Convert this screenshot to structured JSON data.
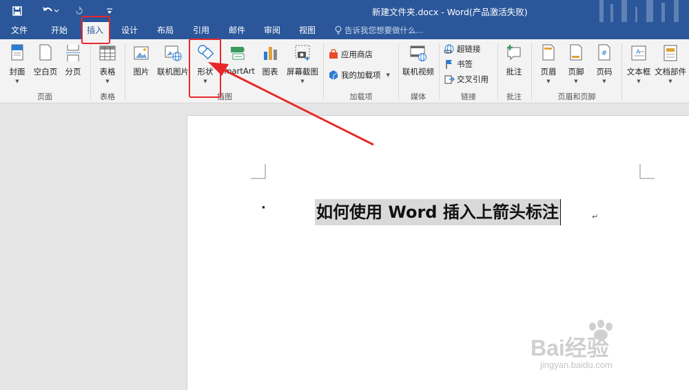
{
  "window": {
    "title": "新建文件夹.docx - Word(产品激活失败)"
  },
  "quick_access": {
    "save_icon": "save-icon",
    "undo_icon": "undo-icon",
    "redo_icon": "redo-icon",
    "customize_icon": "customize-qat-icon"
  },
  "tabs": [
    {
      "label": "文件"
    },
    {
      "label": "开始"
    },
    {
      "label": "插入"
    },
    {
      "label": "设计"
    },
    {
      "label": "布局"
    },
    {
      "label": "引用"
    },
    {
      "label": "邮件"
    },
    {
      "label": "审阅"
    },
    {
      "label": "视图"
    }
  ],
  "tell_me": "告诉我您想要做什么...",
  "ribbon": {
    "pages": {
      "cover": "封面",
      "blank": "空白页",
      "break": "分页",
      "group": "页面"
    },
    "tables": {
      "table": "表格",
      "group": "表格"
    },
    "illustrations": {
      "picture": "图片",
      "online_picture": "联机图片",
      "shapes": "形状",
      "smartart": "SmartArt",
      "chart": "图表",
      "screenshot": "屏幕截图",
      "group": "插图"
    },
    "addins": {
      "store": "应用商店",
      "my_addins": "我的加载项",
      "group": "加载项"
    },
    "media": {
      "online_video": "联机视频",
      "group": "媒体"
    },
    "links": {
      "hyperlink": "超链接",
      "bookmark": "书签",
      "cross_ref": "交叉引用",
      "group": "链接"
    },
    "comments": {
      "comment": "批注",
      "group": "批注"
    },
    "header_footer": {
      "header": "页眉",
      "footer": "页脚",
      "page_number": "页码",
      "group": "页眉和页脚"
    },
    "text": {
      "textbox": "文本框",
      "quick_parts": "文档部件"
    }
  },
  "document": {
    "bullet": "·",
    "heading": "如何使用 Word 插入上箭头标注",
    "para_mark": "↵"
  },
  "watermark": {
    "brand": "Bai经验",
    "url": "jingyan.baidu.com"
  },
  "colors": {
    "title_blue": "#2b579a",
    "annotation_red": "#e8262a"
  }
}
